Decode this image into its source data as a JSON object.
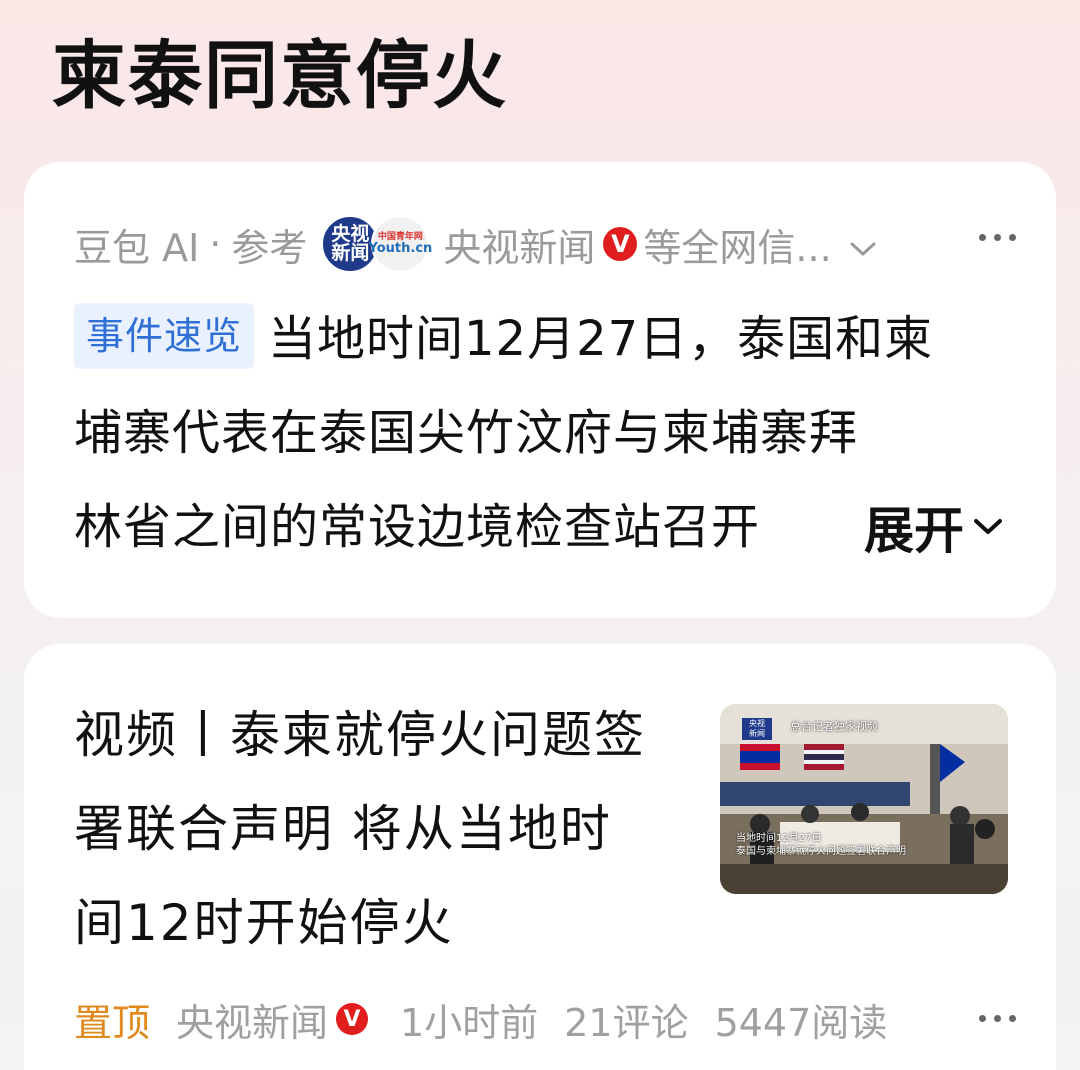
{
  "page": {
    "title": "柬泰同意停火"
  },
  "ai_card": {
    "brand": "豆包 AI",
    "separator": "·",
    "ref_label": "参考",
    "source_icons": [
      {
        "name": "cctv-news-icon",
        "text_top": "央视",
        "text_bottom": "新闻"
      },
      {
        "name": "youth-cn-icon",
        "text_top": "中国青年网",
        "text_bottom": "Youth.cn"
      }
    ],
    "source_name": "央视新闻",
    "verified_badge": "V",
    "sources_suffix": "等全网信...",
    "tag": "事件速览",
    "summary_lines": [
      "当地时间12月27日，泰国和柬",
      "埔寨代表在泰国尖竹汶府与柬埔寨拜",
      "林省之间的常设边境检查站召开"
    ],
    "expand_label": "展开"
  },
  "news_card": {
    "title_lines": [
      "视频丨泰柬就停火问题签",
      "署联合声明 将从当地时",
      "间12时开始停火"
    ],
    "thumbnail": {
      "logo_top": "央视",
      "logo_bottom": "新闻",
      "top_text": "总台记者独家视频",
      "caption_line1": "当地时间12月27日",
      "caption_line2": "泰国与柬埔寨就停火问题签署联合声明"
    },
    "pin_label": "置顶",
    "source": "央视新闻",
    "verified_badge": "V",
    "time": "1小时前",
    "comments": "21评论",
    "reads": "5447阅读"
  },
  "colors": {
    "accent_blue": "#2f6fd6",
    "pin_orange": "#e08a1e",
    "verified_red": "#e01e1e"
  }
}
